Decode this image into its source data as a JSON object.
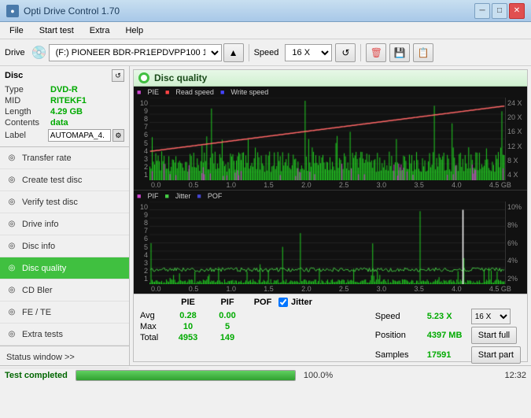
{
  "titlebar": {
    "title": "Opti Drive Control 1.70",
    "icon": "●",
    "minimize_label": "─",
    "maximize_label": "□",
    "close_label": "✕"
  },
  "menubar": {
    "items": [
      {
        "label": "File"
      },
      {
        "label": "Start test"
      },
      {
        "label": "Extra"
      },
      {
        "label": "Help"
      }
    ]
  },
  "toolbar": {
    "drive_label": "Drive",
    "drive_value": "(F:)  PIONEER BDR-PR1EPDVPP100 1.01",
    "speed_label": "Speed",
    "speed_value": "16 X"
  },
  "sidebar": {
    "disc_title": "Disc",
    "disc_info": {
      "type_label": "Type",
      "type_value": "DVD-R",
      "mid_label": "MID",
      "mid_value": "RITEKF1",
      "length_label": "Length",
      "length_value": "4.29 GB",
      "contents_label": "Contents",
      "contents_value": "data",
      "label_label": "Label",
      "label_value": "AUTOMAPA_4."
    },
    "nav_items": [
      {
        "label": "Transfer rate",
        "icon": "◎"
      },
      {
        "label": "Create test disc",
        "icon": "◎"
      },
      {
        "label": "Verify test disc",
        "icon": "◎"
      },
      {
        "label": "Drive info",
        "icon": "◎"
      },
      {
        "label": "Disc info",
        "icon": "◎"
      },
      {
        "label": "Disc quality",
        "icon": "◎",
        "active": true
      },
      {
        "label": "CD Bler",
        "icon": "◎"
      },
      {
        "label": "FE / TE",
        "icon": "◎"
      },
      {
        "label": "Extra tests",
        "icon": "◎"
      }
    ],
    "status_window_label": "Status window >>"
  },
  "disc_quality": {
    "panel_title": "Disc quality",
    "chart1": {
      "legend": [
        {
          "label": "PIE",
          "color": "#cc44cc"
        },
        {
          "label": "Read speed",
          "color": "#ff4444"
        },
        {
          "label": "Write speed",
          "color": "#4444ff"
        }
      ],
      "y_left_labels": [
        "10",
        "9",
        "8",
        "7",
        "6",
        "5",
        "4",
        "3",
        "2",
        "1"
      ],
      "y_right_labels": [
        "24 X",
        "20 X",
        "16 X",
        "12 X",
        "8 X",
        "4 X"
      ],
      "x_labels": [
        "0.0",
        "0.5",
        "1.0",
        "1.5",
        "2.0",
        "2.5",
        "3.0",
        "3.5",
        "4.0",
        "4.5 GB"
      ]
    },
    "chart2": {
      "legend": [
        {
          "label": "PIF",
          "color": "#cc44cc"
        },
        {
          "label": "Jitter",
          "color": "#44cc44"
        },
        {
          "label": "POF",
          "color": "#4444cc"
        }
      ],
      "y_left_labels": [
        "10",
        "9",
        "8",
        "7",
        "6",
        "5",
        "4",
        "3",
        "2",
        "1"
      ],
      "y_right_labels": [
        "10%",
        "8%",
        "6%",
        "4%",
        "2%"
      ],
      "x_labels": [
        "0.0",
        "0.5",
        "1.0",
        "1.5",
        "2.0",
        "2.5",
        "3.0",
        "3.5",
        "4.0",
        "4.5 GB"
      ]
    }
  },
  "stats": {
    "headers": [
      "PIE",
      "PIF",
      "POF",
      "Jitter"
    ],
    "rows": [
      {
        "label": "Avg",
        "pie": "0.28",
        "pif": "0.00"
      },
      {
        "label": "Max",
        "pie": "10",
        "pif": "5"
      },
      {
        "label": "Total",
        "pie": "4953",
        "pif": "149"
      }
    ],
    "speed_label": "Speed",
    "speed_value": "5.23 X",
    "position_label": "Position",
    "position_value": "4397 MB",
    "samples_label": "Samples",
    "samples_value": "17591",
    "speed_select": "16 X",
    "start_full_label": "Start full",
    "start_part_label": "Start part",
    "jitter_checked": true,
    "jitter_label": "Jitter"
  },
  "statusbar": {
    "status_text": "Test completed",
    "progress_percent": 100,
    "progress_label": "100.0%",
    "time": "12:32"
  }
}
